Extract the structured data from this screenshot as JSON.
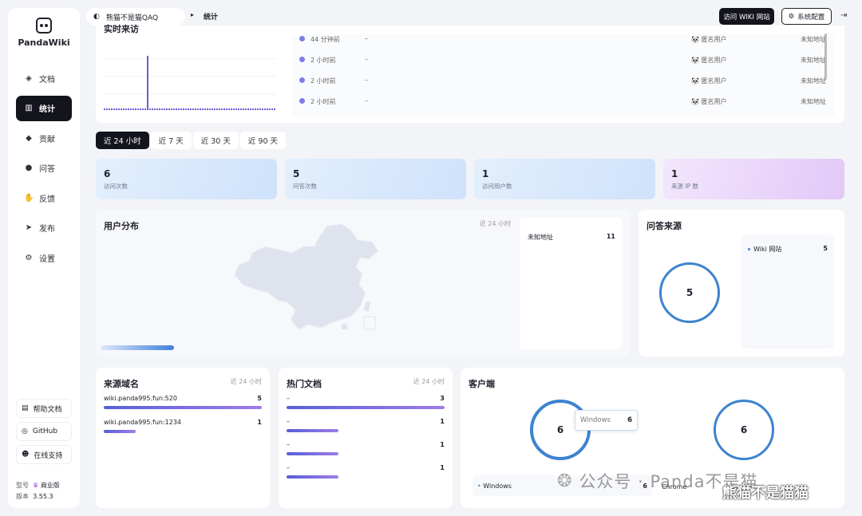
{
  "app": {
    "name": "PandaWiki"
  },
  "sidebar": {
    "items": [
      {
        "label": "文档",
        "icon": "layers-icon"
      },
      {
        "label": "统计",
        "icon": "bar-chart-icon",
        "active": true
      },
      {
        "label": "贡献",
        "icon": "diamond-icon"
      },
      {
        "label": "问答",
        "icon": "chat-icon"
      },
      {
        "label": "反馈",
        "icon": "thumbs-up-icon"
      },
      {
        "label": "发布",
        "icon": "send-icon"
      },
      {
        "label": "设置",
        "icon": "gear-icon"
      }
    ],
    "links": [
      {
        "label": "帮助文档",
        "icon": "doc-icon"
      },
      {
        "label": "GitHub",
        "icon": "github-icon"
      },
      {
        "label": "在线支持",
        "icon": "support-icon"
      }
    ],
    "meta": {
      "model_label": "型号",
      "model_value": "商业版",
      "version_label": "版本",
      "version_value": "3.55.3"
    }
  },
  "header": {
    "kb_name": "熊猫不是猫QAQ",
    "current": "统计",
    "visit_button": "访问 WIKI 网站",
    "config_button": "系统配置"
  },
  "recent_visits": {
    "title": "实时来访",
    "rows": [
      {
        "time": "44 分钟前",
        "page": "–",
        "user": "匿名用户",
        "location": "未知地址"
      },
      {
        "time": "2 小时前",
        "page": "–",
        "user": "匿名用户",
        "location": "未知地址"
      },
      {
        "time": "2 小时前",
        "page": "–",
        "user": "匿名用户",
        "location": "未知地址"
      },
      {
        "time": "2 小时前",
        "page": "–",
        "user": "匿名用户",
        "location": "未知地址"
      }
    ]
  },
  "tabs": [
    "近 24 小时",
    "近 7 天",
    "近 30 天",
    "近 90 天"
  ],
  "stats": [
    {
      "value": "6",
      "label": "访问次数"
    },
    {
      "value": "5",
      "label": "问答次数"
    },
    {
      "value": "1",
      "label": "访问用户数"
    },
    {
      "value": "1",
      "label": "来源 IP 数"
    }
  ],
  "user_distribution": {
    "title": "用户分布",
    "range": "近 24 小时",
    "locations": [
      {
        "name": "未知地址",
        "count": "11"
      }
    ]
  },
  "qa_sources": {
    "title": "问答来源",
    "total": "5",
    "legend": [
      {
        "name": "Wiki 网站",
        "count": "5"
      }
    ]
  },
  "referrers": {
    "title": "来源域名",
    "range": "近 24 小时",
    "rows": [
      {
        "name": "wiki.panda995.fun:520",
        "value": "5",
        "fraction": 1.0
      },
      {
        "name": "wiki.panda995.fun:1234",
        "value": "1",
        "fraction": 0.2
      }
    ]
  },
  "hot_docs": {
    "title": "热门文档",
    "range": "近 24 小时",
    "rows": [
      {
        "name": "–",
        "value": "3",
        "fraction": 1.0
      },
      {
        "name": "–",
        "value": "1",
        "fraction": 0.33
      },
      {
        "name": "–",
        "value": "1",
        "fraction": 0.33
      },
      {
        "name": "–",
        "value": "1",
        "fraction": 0.33
      }
    ]
  },
  "clients": {
    "title": "客户端",
    "ring1_total": "6",
    "ring2_total": "6",
    "tooltip": {
      "name": "Windows",
      "count": "6"
    },
    "legend": [
      {
        "name": "Windows",
        "count": "6"
      },
      {
        "name": "Chrome"
      }
    ]
  },
  "watermark": {
    "text": "公众号 · Panda不是猫",
    "overlay": "熊猫不是猫猫"
  },
  "colors": {
    "accent": "#14151c",
    "ring": "#3d83cf",
    "bar_start": "#5660d6",
    "bar_end": "#9f7be8"
  }
}
